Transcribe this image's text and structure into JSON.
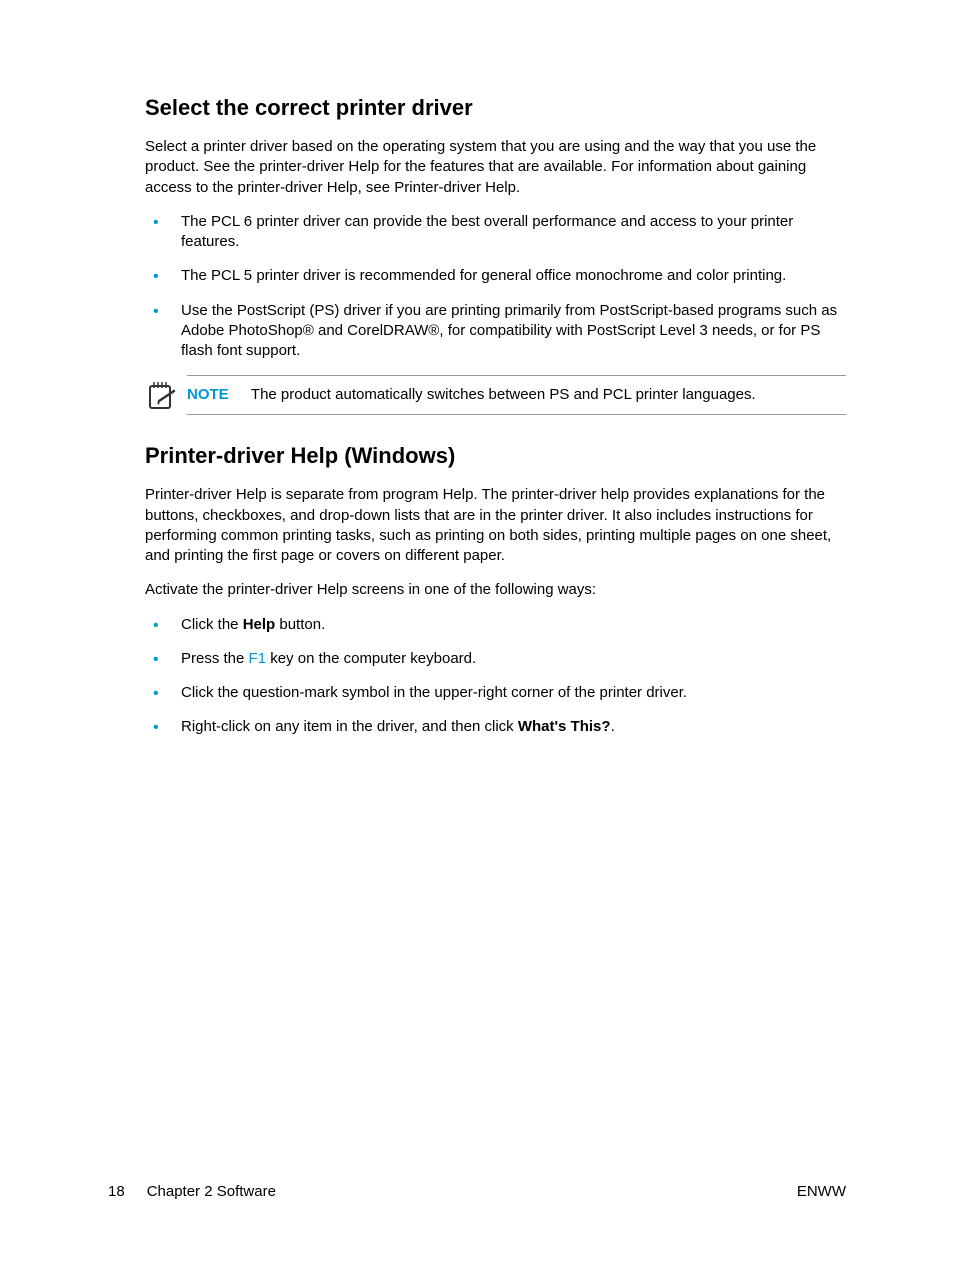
{
  "section1": {
    "heading": "Select the correct printer driver",
    "intro": "Select a printer driver based on the operating system that you are using and the way that you use the product. See the printer-driver Help for the features that are available. For information about gaining access to the printer-driver Help, see Printer-driver Help.",
    "bullets": [
      "The PCL 6 printer driver can provide the best overall performance and access to your printer features.",
      "The PCL 5 printer driver is recommended for general office monochrome and color printing.",
      "Use the PostScript (PS) driver if you are printing primarily from PostScript-based programs such as Adobe PhotoShop® and CorelDRAW®, for compatibility with PostScript Level 3 needs, or for PS flash font support."
    ],
    "note": {
      "label": "NOTE",
      "text": "The product automatically switches between PS and PCL printer languages."
    }
  },
  "section2": {
    "heading": "Printer-driver Help (Windows)",
    "para1": "Printer-driver Help is separate from program Help. The printer-driver help provides explanations for the buttons, checkboxes, and drop-down lists that are in the printer driver. It also includes instructions for performing common printing tasks, such as printing on both sides, printing multiple pages on one sheet, and printing the first page or covers on different paper.",
    "para2": "Activate the printer-driver Help screens in one of the following ways:",
    "bullets": {
      "b1_pre": "Click the ",
      "b1_bold": "Help",
      "b1_post": " button.",
      "b2_pre": "Press the ",
      "b2_key": "F1",
      "b2_post": " key on the computer keyboard.",
      "b3": "Click the question-mark symbol in the upper-right corner of the printer driver.",
      "b4_pre": "Right-click on any item in the driver, and then click ",
      "b4_bold": "What's This?",
      "b4_post": "."
    }
  },
  "footer": {
    "page": "18",
    "chapter": "Chapter 2   Software",
    "region": "ENWW"
  }
}
